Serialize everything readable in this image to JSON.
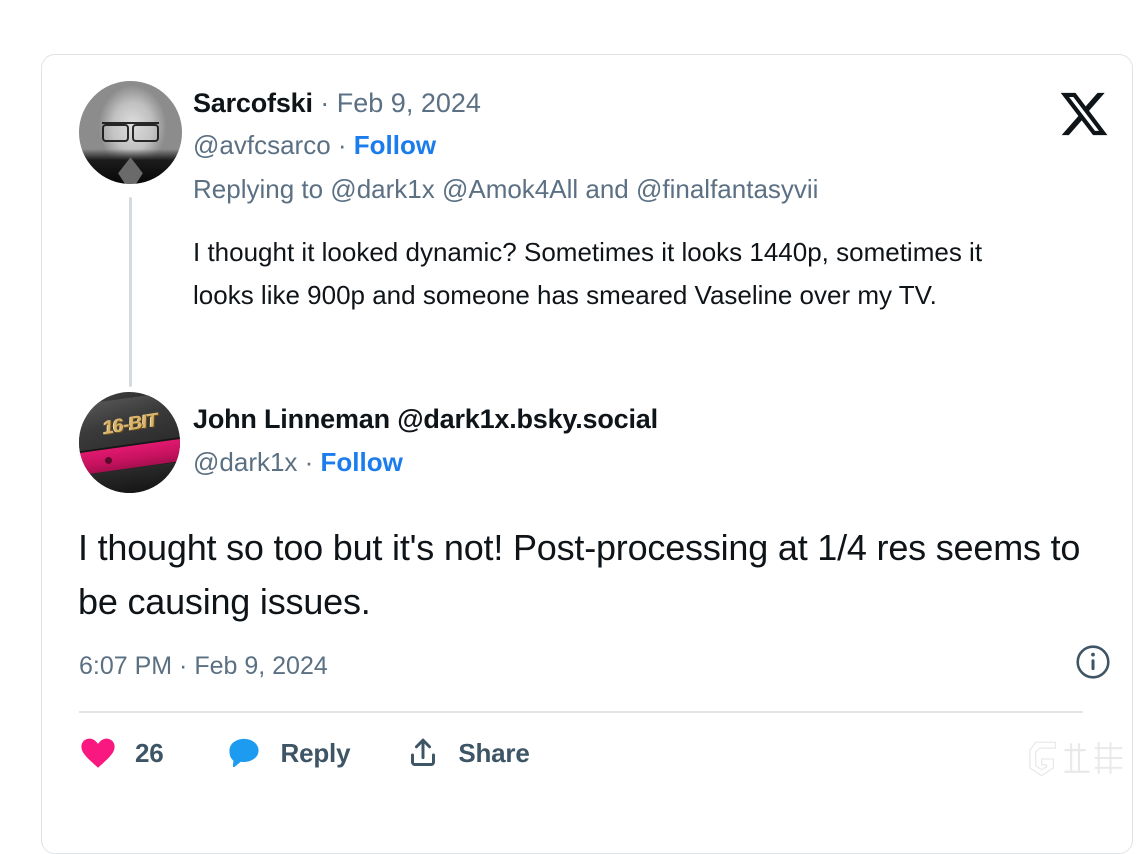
{
  "platform": {
    "name": "X",
    "logo_icon": "x-logo-icon"
  },
  "parent_tweet": {
    "author": {
      "display_name": "Sarcofski",
      "handle": "@avfcsarco",
      "avatar_icon": "avatar-portrait-photo"
    },
    "separator": "·",
    "date": "Feb 9, 2024",
    "follow_label": "Follow",
    "replying_to": "Replying to @dark1x @Amok4All and @finalfantasyvii",
    "body": "I thought it looked dynamic? Sometimes it looks 1440p, sometimes it looks like 900p and someone has smeared Vaseline over my TV."
  },
  "main_tweet": {
    "author": {
      "display_name": "John Linneman @dark1x.bsky.social",
      "handle": "@dark1x",
      "avatar_icon": "avatar-16bit-console"
    },
    "separator": "·",
    "follow_label": "Follow",
    "body": "I thought so too but it's not! Post-processing at 1/4 res seems to be causing issues.",
    "timestamp": "6:07 PM · Feb 9, 2024",
    "info_icon": "info-circle-icon"
  },
  "actions": {
    "like": {
      "icon": "heart-filled-icon",
      "count": "26",
      "color": "#f91880"
    },
    "reply": {
      "icon": "speech-bubble-filled-icon",
      "label": "Reply",
      "color": "#1d9bf0"
    },
    "share": {
      "icon": "share-arrow-icon",
      "label": "Share",
      "color": "#3d5565"
    }
  },
  "watermark": {
    "text": "九游",
    "logo_icon": "g-logo-icon"
  },
  "colors": {
    "link_blue": "#1b7ced",
    "muted_text": "#5b7083",
    "primary_text": "#0f1419",
    "card_border": "#dfe3e6",
    "divider": "#e2e5e8"
  }
}
